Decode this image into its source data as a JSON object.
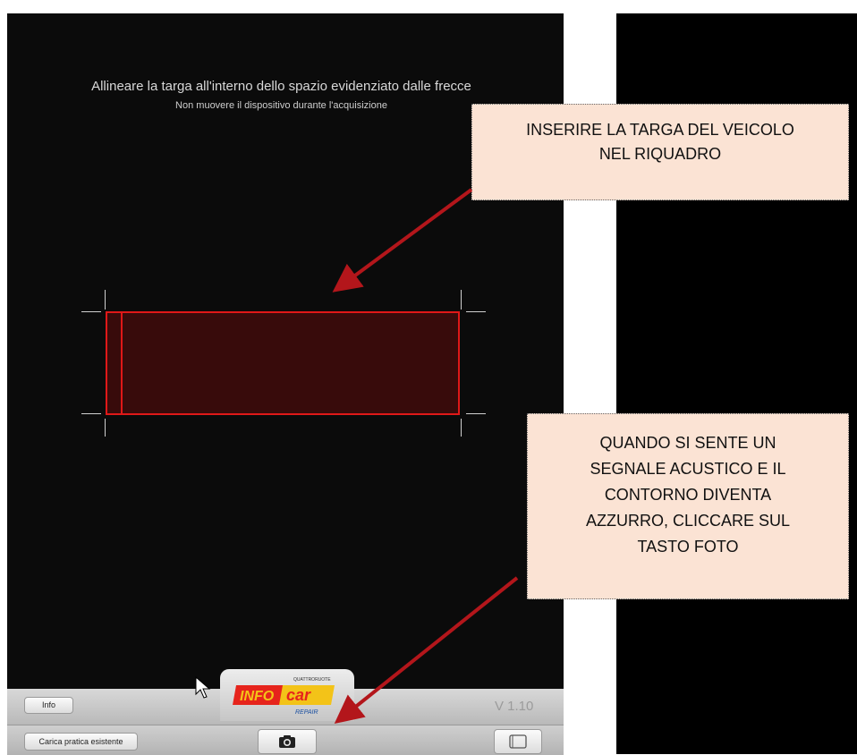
{
  "instructions": {
    "line1": "Allineare la targa all'interno dello spazio evidenziato dalle frecce",
    "line2": "Non muovere il dispositivo durante l'acquisizione"
  },
  "callouts": {
    "plate": {
      "lines": [
        "INSERIRE LA TARGA DEL VEICOLO",
        "NEL RIQUADRO"
      ]
    },
    "photo": {
      "lines": [
        "QUANDO SI SENTE UN",
        "SEGNALE ACUSTICO E IL",
        "CONTORNO DIVENTA",
        "AZZURRO, CLICCARE SUL",
        "TASTO FOTO"
      ]
    }
  },
  "toolbar": {
    "info_label": "Info",
    "load_label": "Carica pratica esistente",
    "version": "V 1.10"
  },
  "logo": {
    "top": "QUATTRORUOTE",
    "main_left": "INFO",
    "main_right": "car",
    "bottom": "REPAIR"
  },
  "icons": {
    "camera": "camera-icon",
    "square": "square-icon",
    "cursor": "mouse-pointer-icon",
    "arrow": "annotation-arrow-icon"
  },
  "colors": {
    "plate_outline": "#e01818",
    "callout_bg": "#fbe3d4",
    "arrow": "#b3161b",
    "logo_red": "#e6241c",
    "logo_yellow": "#f3c318"
  }
}
